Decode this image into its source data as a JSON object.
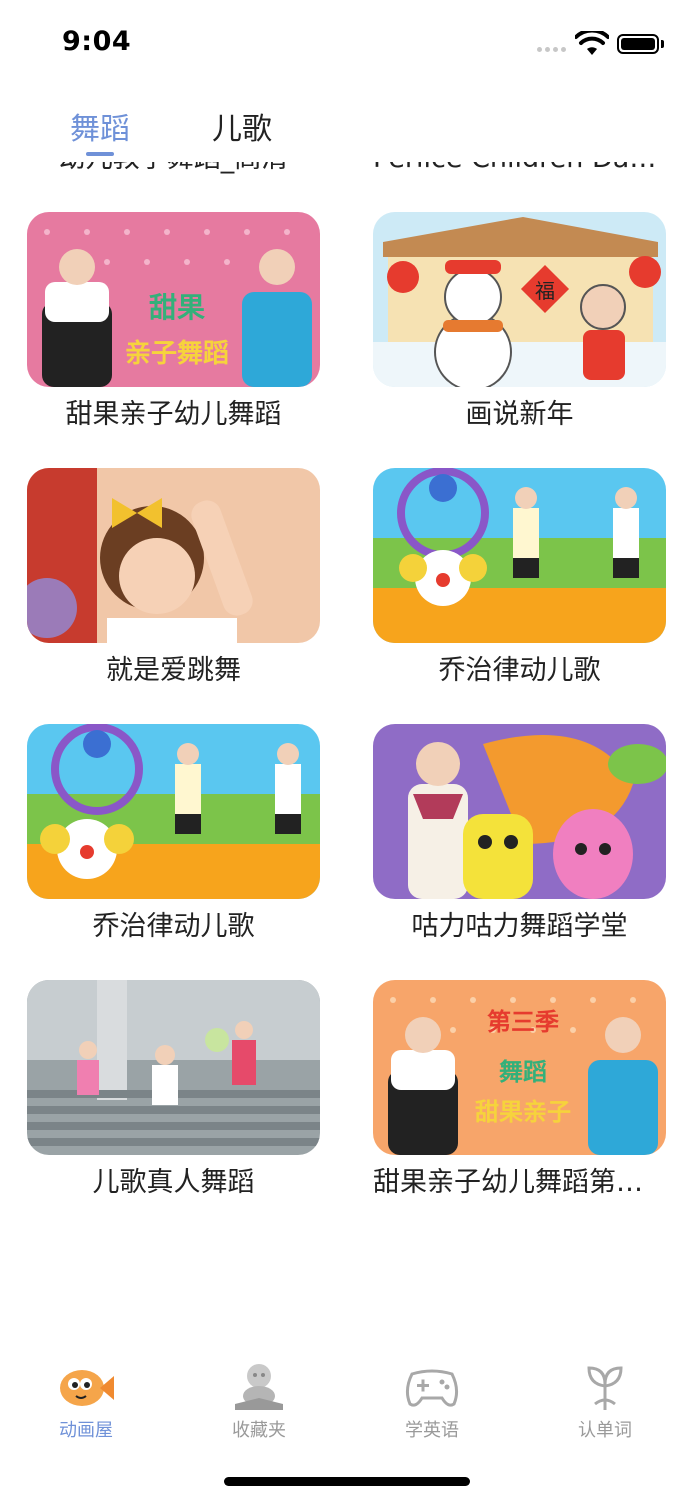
{
  "status_bar": {
    "time": "9:04"
  },
  "tabs": [
    {
      "label": "舞蹈",
      "active": true
    },
    {
      "label": "儿歌",
      "active": false
    }
  ],
  "videos": [
    {
      "title": "幼儿教学舞蹈_高清"
    },
    {
      "title": "Perlice Children Dance"
    },
    {
      "title": "甜果亲子幼儿舞蹈"
    },
    {
      "title": "画说新年"
    },
    {
      "title": "就是爱跳舞"
    },
    {
      "title": "乔治律动儿歌"
    },
    {
      "title": "乔治律动儿歌"
    },
    {
      "title": "咕力咕力舞蹈学堂"
    },
    {
      "title": "儿歌真人舞蹈"
    },
    {
      "title": "甜果亲子幼儿舞蹈第三季"
    }
  ],
  "thumb_text": {
    "tianguo_line1": "甜果",
    "tianguo_line2": "亲子舞蹈",
    "fu": "福",
    "season": "第三季",
    "season_line2": "舞蹈",
    "season_line3": "甜果亲子"
  },
  "bottom_nav": [
    {
      "label": "动画屋",
      "icon": "fish-icon",
      "active": true
    },
    {
      "label": "收藏夹",
      "icon": "baby-reading-icon",
      "active": false
    },
    {
      "label": "学英语",
      "icon": "gamepad-icon",
      "active": false
    },
    {
      "label": "认单词",
      "icon": "sprout-icon",
      "active": false
    }
  ],
  "colors": {
    "accent": "#6f91d8",
    "inactive": "#9a9a9a"
  }
}
